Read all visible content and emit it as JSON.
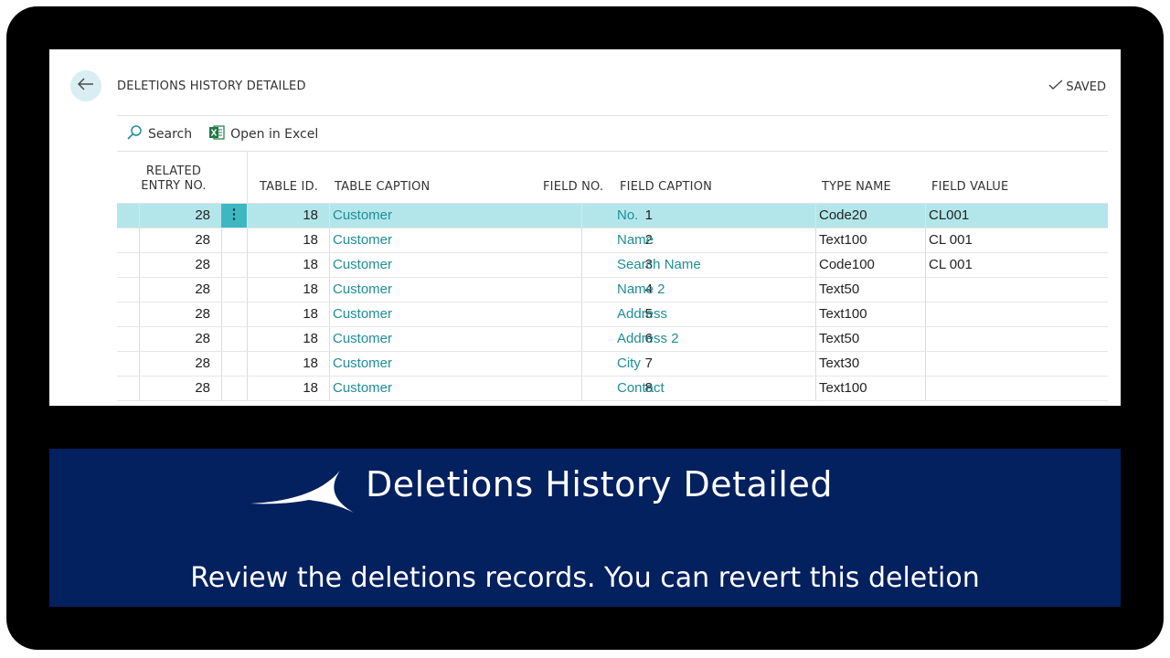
{
  "page": {
    "title": "DELETIONS HISTORY DETAILED",
    "saved_label": "SAVED"
  },
  "actions": {
    "search_label": "Search",
    "excel_label": "Open in Excel"
  },
  "colors": {
    "accent": "#1e8e96",
    "selected_row": "#b3e6ea",
    "banner_bg": "#03205f"
  },
  "icons": [
    "back-arrow-icon",
    "checkmark-icon",
    "search-icon",
    "excel-icon",
    "row-menu-dots-icon",
    "swoosh-logo-icon"
  ],
  "table": {
    "headers": {
      "related_entry_no_line1": "RELATED",
      "related_entry_no_line2": "ENTRY NO.",
      "table_id": "TABLE ID.",
      "table_caption": "TABLE CAPTION",
      "field_no": "FIELD NO.",
      "field_caption": "FIELD CAPTION",
      "type_name": "TYPE NAME",
      "field_value": "FIELD VALUE"
    },
    "row_menu_glyph": "⋮",
    "rows": [
      {
        "related_entry_no": "28",
        "table_id": "18",
        "table_caption": "Customer",
        "field_no": "1",
        "field_caption": "No.",
        "type_name": "Code20",
        "field_value": "CL001"
      },
      {
        "related_entry_no": "28",
        "table_id": "18",
        "table_caption": "Customer",
        "field_no": "2",
        "field_caption": "Name",
        "type_name": "Text100",
        "field_value": "CL 001"
      },
      {
        "related_entry_no": "28",
        "table_id": "18",
        "table_caption": "Customer",
        "field_no": "3",
        "field_caption": "Search Name",
        "type_name": "Code100",
        "field_value": "CL 001"
      },
      {
        "related_entry_no": "28",
        "table_id": "18",
        "table_caption": "Customer",
        "field_no": "4",
        "field_caption": "Name 2",
        "type_name": "Text50",
        "field_value": ""
      },
      {
        "related_entry_no": "28",
        "table_id": "18",
        "table_caption": "Customer",
        "field_no": "5",
        "field_caption": "Address",
        "type_name": "Text100",
        "field_value": ""
      },
      {
        "related_entry_no": "28",
        "table_id": "18",
        "table_caption": "Customer",
        "field_no": "6",
        "field_caption": "Address 2",
        "type_name": "Text50",
        "field_value": ""
      },
      {
        "related_entry_no": "28",
        "table_id": "18",
        "table_caption": "Customer",
        "field_no": "7",
        "field_caption": "City",
        "type_name": "Text30",
        "field_value": ""
      },
      {
        "related_entry_no": "28",
        "table_id": "18",
        "table_caption": "Customer",
        "field_no": "8",
        "field_caption": "Contact",
        "type_name": "Text100",
        "field_value": ""
      }
    ]
  },
  "banner": {
    "title": "Deletions History Detailed",
    "subtitle": "Review the deletions records. You can revert this deletion"
  }
}
